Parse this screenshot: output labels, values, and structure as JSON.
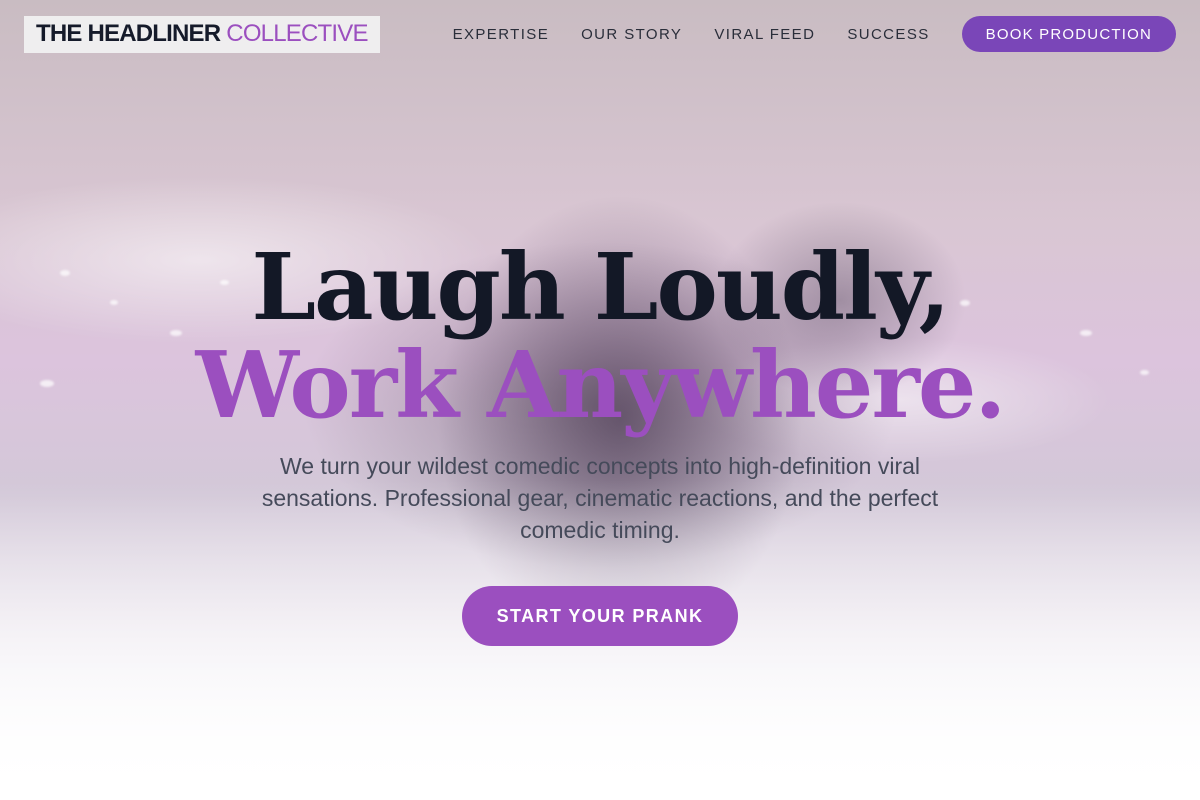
{
  "brand": {
    "name_primary": "THE HEADLINER",
    "name_accent": "COLLECTIVE"
  },
  "nav": {
    "items": [
      {
        "label": "EXPERTISE"
      },
      {
        "label": "OUR STORY"
      },
      {
        "label": "VIRAL FEED"
      },
      {
        "label": "SUCCESS"
      }
    ],
    "cta_label": "BOOK PRODUCTION"
  },
  "hero": {
    "headline_line1": "Laugh Loudly,",
    "headline_line2": "Work Anywhere.",
    "subtitle": "We turn your wildest comedic concepts into high-definition viral sensations. Professional gear, cinematic reactions, and the perfect comedic timing.",
    "cta_label": "START YOUR PRANK"
  },
  "colors": {
    "accent": "#9b4fbf",
    "nav_button": "#7a46b8",
    "headline_dark": "#131826",
    "body_text": "#454a5a"
  }
}
